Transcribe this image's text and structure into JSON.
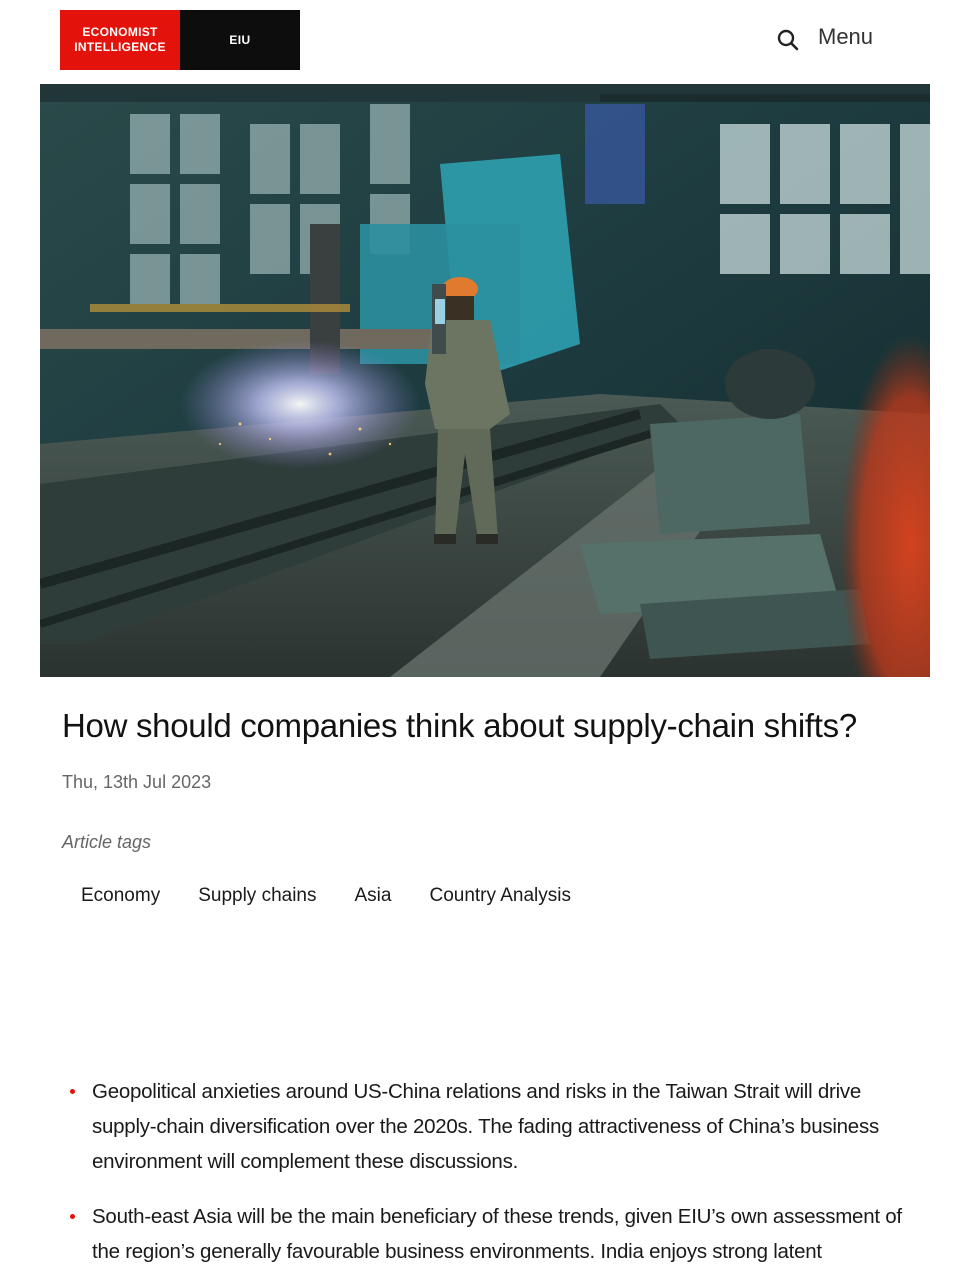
{
  "header": {
    "logo_line1": "ECONOMIST",
    "logo_line2": "INTELLIGENCE",
    "logo_short": "EIU",
    "search_icon": "search-icon",
    "menu_label": "Menu"
  },
  "hero": {
    "icon": "factory-photo"
  },
  "article": {
    "title": "How should companies think about supply-chain shifts?",
    "date": "Thu, 13th Jul 2023",
    "tags_label": "Article tags",
    "tags": [
      "Economy",
      "Supply chains",
      "Asia",
      "Country Analysis"
    ],
    "bullets": [
      "Geopolitical anxieties around US-China relations and risks in the Taiwan Strait will drive supply-chain diversification over the 2020s. The fading attractiveness of China’s business environment will complement these discussions.",
      "South-east Asia will be the main beneficiary of these trends, given EIU’s own assessment of the region’s generally favourable business environments. India enjoys strong latent"
    ]
  },
  "colors": {
    "brand_red": "#e3120b",
    "brand_black": "#0d0d0d"
  }
}
